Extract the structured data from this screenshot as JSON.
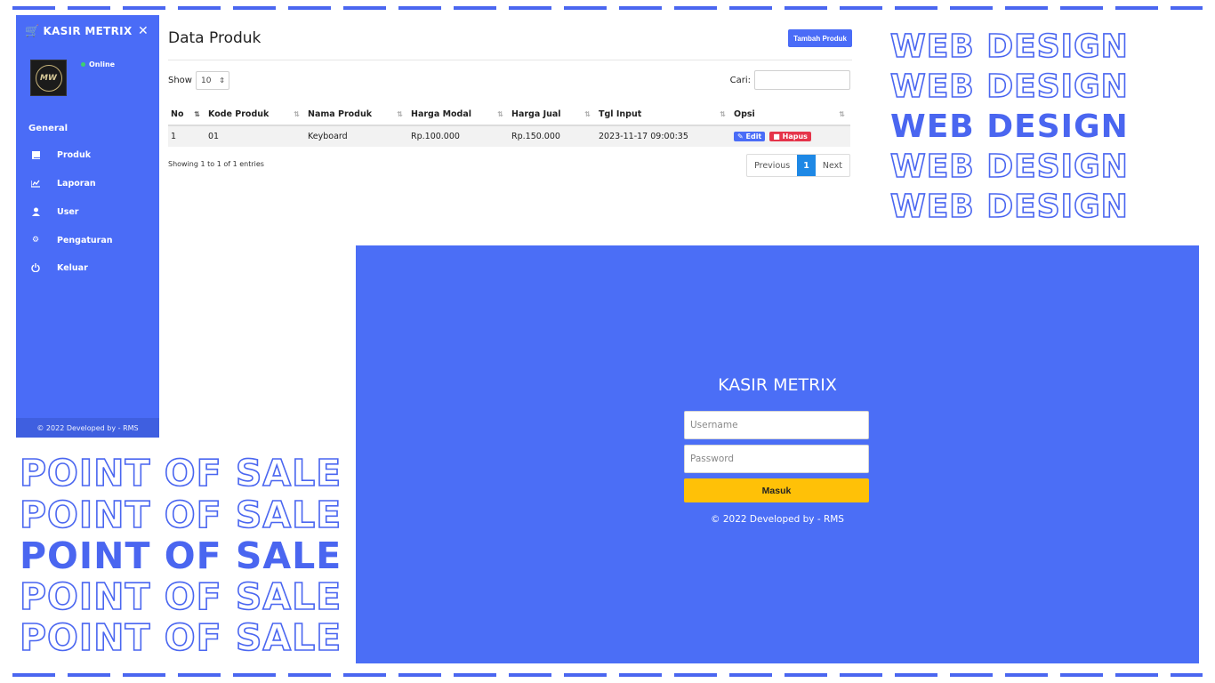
{
  "sidebar": {
    "brand": "KASIR METRIX",
    "status": "Online",
    "section": "General",
    "items": [
      {
        "label": "Produk",
        "icon": "book-icon"
      },
      {
        "label": "Laporan",
        "icon": "chart-icon"
      },
      {
        "label": "User",
        "icon": "user-icon"
      },
      {
        "label": "Pengaturan",
        "icon": "gear-icon"
      },
      {
        "label": "Keluar",
        "icon": "power-icon"
      }
    ],
    "footer": "© 2022 Developed by - RMS"
  },
  "content": {
    "title": "Data Produk",
    "add_button": "Tambah Produk",
    "show_label": "Show",
    "show_value": "10",
    "search_label": "Cari:",
    "columns": [
      "No",
      "Kode Produk",
      "Nama Produk",
      "Harga Modal",
      "Harga Jual",
      "Tgl Input",
      "Opsi"
    ],
    "rows": [
      {
        "no": "1",
        "kode": "01",
        "nama": "Keyboard",
        "modal": "Rp.100.000",
        "jual": "Rp.150.000",
        "tgl": "2023-11-17 09:00:35",
        "edit": "Edit",
        "hapus": "Hapus"
      }
    ],
    "entries": "Showing 1 to 1 of 1 entries",
    "pager": {
      "prev": "Previous",
      "page": "1",
      "next": "Next"
    }
  },
  "deco": {
    "web": "WEB DESIGN",
    "pos": "POINT OF SALE"
  },
  "login": {
    "title": "KASIR METRIX",
    "username_placeholder": "Username",
    "password_placeholder": "Password",
    "button": "Masuk",
    "footer": "© 2022 Developed by - RMS"
  },
  "colors": {
    "accent": "#4a6cf7",
    "warning": "#ffc107",
    "danger": "#e5344a"
  }
}
